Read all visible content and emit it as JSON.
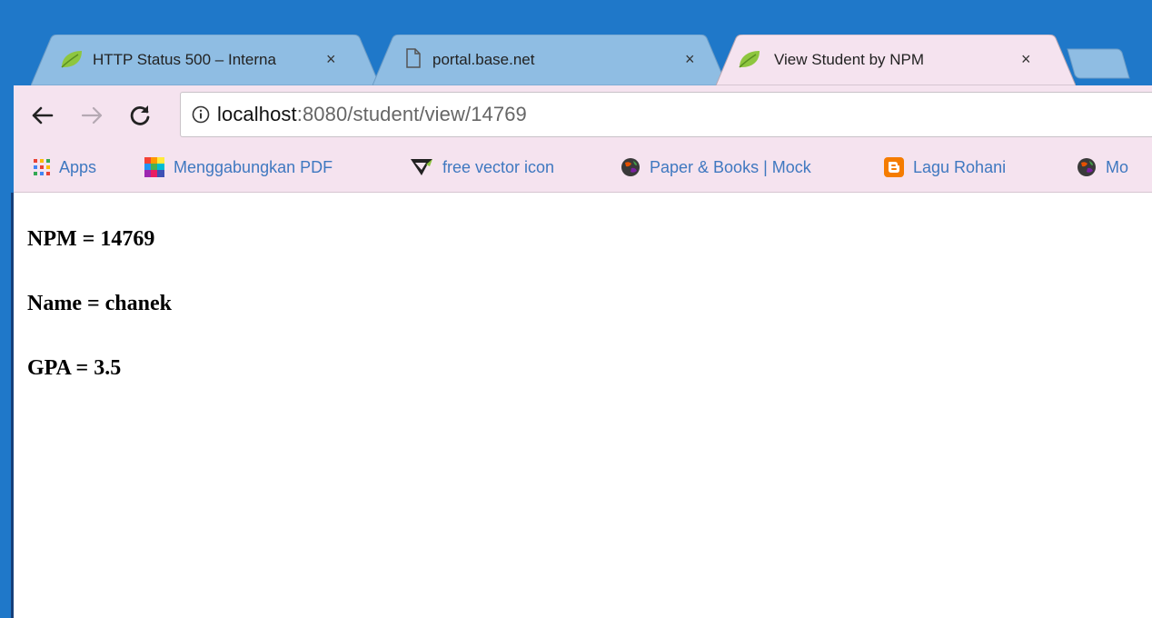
{
  "browser": {
    "tabs": [
      {
        "title": "HTTP Status 500 – Interna",
        "icon": "spring-leaf-icon",
        "active": false
      },
      {
        "title": "portal.base.net",
        "icon": "document-icon",
        "active": false
      },
      {
        "title": "View Student by NPM",
        "icon": "spring-leaf-icon",
        "active": true
      }
    ],
    "close_glyph": "×",
    "address": {
      "host": "localhost",
      "rest": ":8080/student/view/14769"
    },
    "bookmarks": [
      {
        "label": "Apps",
        "icon": "apps-grid-icon"
      },
      {
        "label": "Menggabungkan PDF",
        "icon": "color-squares-icon"
      },
      {
        "label": "free vector icon",
        "icon": "vector-logo-icon"
      },
      {
        "label": "Paper & Books | Mock",
        "icon": "globe-icon"
      },
      {
        "label": "Lagu Rohani",
        "icon": "blogger-icon"
      },
      {
        "label": "Mo",
        "icon": "globe-icon"
      }
    ]
  },
  "page": {
    "npm_line": "NPM = 14769",
    "name_line": "Name = chanek",
    "gpa_line": "GPA = 3.5"
  },
  "colors": {
    "frame": "#1f78c9",
    "inactive_tab": "#8fbde3",
    "active_tab": "#f5e3ef",
    "toolbar": "#f5e3ef",
    "bookmark_text": "#3f78c0"
  }
}
